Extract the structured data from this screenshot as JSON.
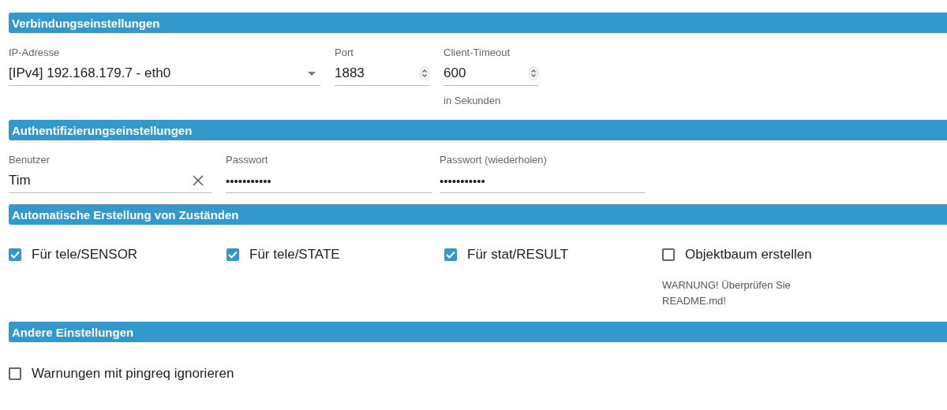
{
  "sections": [
    {
      "title": "Verbindungseinstellungen",
      "fields": [
        {
          "kind": "select",
          "label": "IP-Adresse",
          "value": "[IPv4] 192.168.179.7 - eth0"
        },
        {
          "kind": "number",
          "label": "Port",
          "value": "1883"
        },
        {
          "kind": "number",
          "label": "Client-Timeout",
          "value": "600",
          "helper": "in Sekunden"
        }
      ]
    },
    {
      "title": "Authentifizierungseinstellungen",
      "fields": [
        {
          "kind": "text",
          "label": "Benutzer",
          "value": "Tim"
        },
        {
          "kind": "password",
          "label": "Passwort",
          "value": "•••••••••••"
        },
        {
          "kind": "password",
          "label": "Passwort (wiederholen)",
          "value": "•••••••••••"
        }
      ]
    },
    {
      "title": "Automatische Erstellung von Zuständen",
      "checkboxes": [
        {
          "label": "Für tele/SENSOR",
          "checked": true
        },
        {
          "label": "Für tele/STATE",
          "checked": true
        },
        {
          "label": "Für stat/RESULT",
          "checked": true
        },
        {
          "label": "Objektbaum erstellen",
          "checked": false,
          "helper": "WARNUNG! Überprüfen Sie README.md!"
        }
      ]
    },
    {
      "title": "Andere Einstellungen",
      "checkboxes": [
        {
          "label": "Warnungen mit pingreq ignorieren",
          "checked": false
        }
      ]
    }
  ]
}
